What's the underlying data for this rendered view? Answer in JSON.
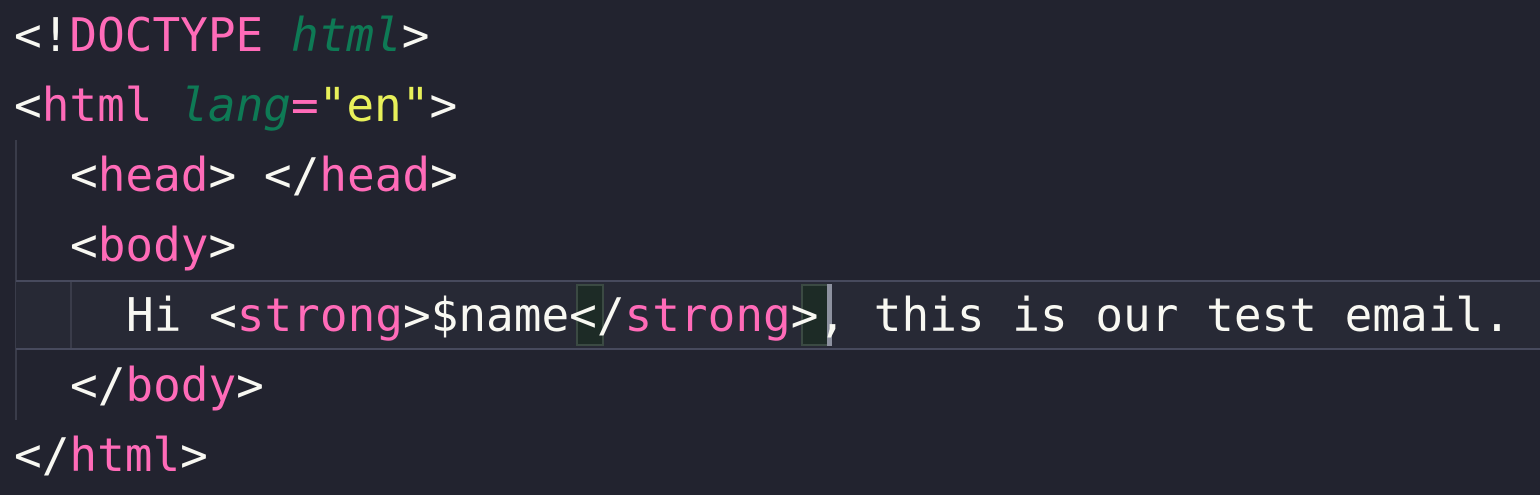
{
  "editor": {
    "language": "html",
    "theme_colors": {
      "background": "#22232f",
      "tag": "#ff6bb8",
      "attribute": "#0e7a55",
      "string": "#e8f05a",
      "text": "#f8f8f2"
    },
    "lines": [
      {
        "open": "<!",
        "keyword": "DOCTYPE",
        "attr": "html",
        "close": ">"
      },
      {
        "open": "<",
        "tag": "html",
        "attr": "lang",
        "eq": "=",
        "value": "\"en\"",
        "close": ">"
      },
      {
        "open1": "<",
        "tag1": "head",
        "close1": ">",
        "space": " ",
        "open2": "</",
        "tag2": "head",
        "close2": ">"
      },
      {
        "open": "<",
        "tag": "body",
        "close": ">"
      },
      {
        "text1": "Hi ",
        "open1": "<",
        "tag1": "strong",
        "close1": ">",
        "variable": "$name",
        "open2": "</",
        "tag2": "strong",
        "close2": ">",
        "text2": ", this is our test email."
      },
      {
        "open": "</",
        "tag": "body",
        "close": ">"
      },
      {
        "open": "</",
        "tag": "html",
        "close": ">"
      }
    ]
  }
}
